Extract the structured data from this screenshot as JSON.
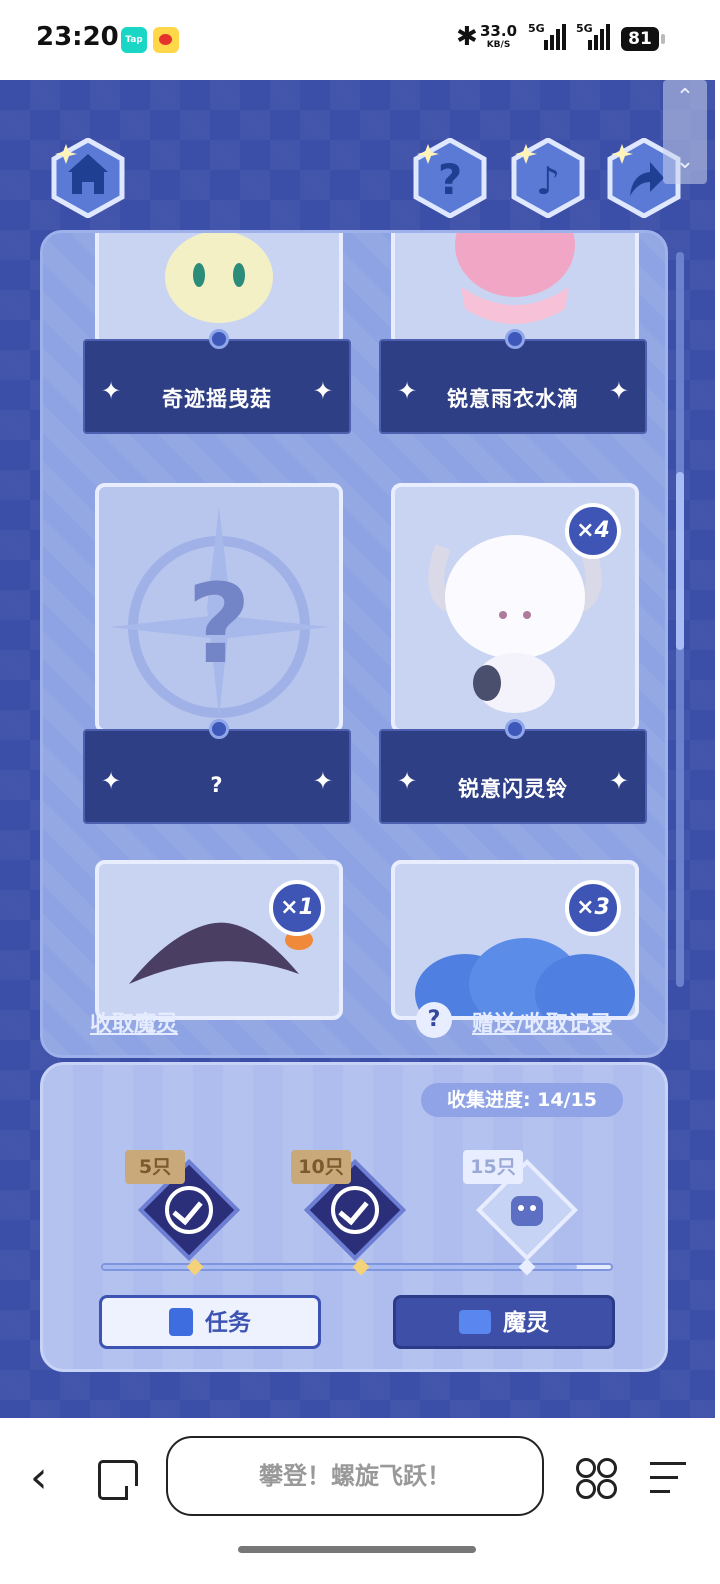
{
  "status_bar": {
    "time": "23:20",
    "app_icons": [
      "tap-icon",
      "weibo-icon"
    ],
    "bluetooth_icon": "bluetooth-icon",
    "speed_value": "33.0",
    "speed_unit": "KB/S",
    "net1": "5G",
    "net2": "5G",
    "battery": "81"
  },
  "top_buttons": [
    "home-icon",
    "help-icon",
    "music-icon",
    "share-icon"
  ],
  "collection": {
    "cards": [
      {
        "name": "奇迹摇曳菇",
        "count": ""
      },
      {
        "name": "锐意雨衣水滴",
        "count": ""
      },
      {
        "name": "?",
        "count": ""
      },
      {
        "name": "锐意闪灵铃",
        "count": "×4"
      },
      {
        "name": "",
        "count": "×1"
      },
      {
        "name": "",
        "count": "×3"
      }
    ],
    "collect_link": "收取魔灵",
    "help_mark": "?",
    "record_link": "赠送/收取记录"
  },
  "progress": {
    "label": "收集进度:  14/15",
    "current": 14,
    "total": 15,
    "milestones": [
      {
        "label": "5只",
        "done": true
      },
      {
        "label": "10只",
        "done": true
      },
      {
        "label": "15只",
        "done": false
      }
    ],
    "task_button": "任务",
    "spirit_button": "魔灵"
  },
  "browser": {
    "address_text": "攀登！螺旋飞跃！",
    "icons": [
      "back-icon",
      "tabs-icon",
      "apps-icon",
      "menu-icon"
    ]
  },
  "colors": {
    "background": "#3b4ea8",
    "panel": "#8ea3e3",
    "card_plate": "#2f3f85",
    "accent": "#3e55b6"
  }
}
